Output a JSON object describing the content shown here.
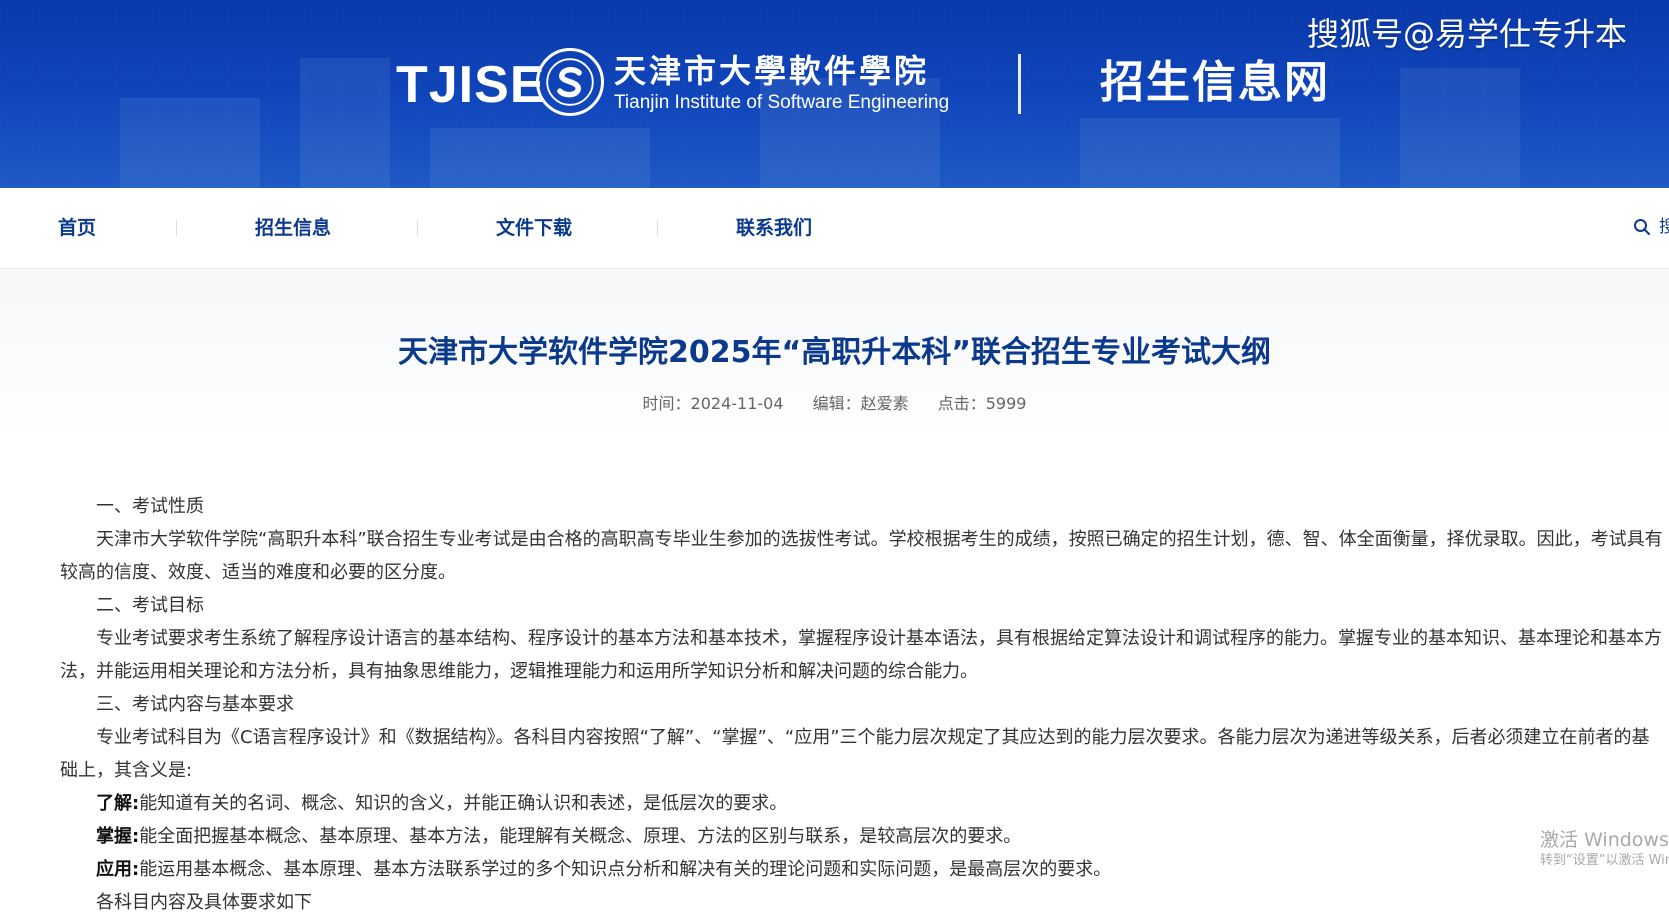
{
  "header": {
    "logo_text": "TJISE",
    "school_name_cn": "天津市大學軟件學院",
    "school_name_en": "Tianjin Institute of Software Engineering",
    "portal_title": "招生信息网",
    "watermark": "搜狐号@易学仕专升本"
  },
  "nav": {
    "items": [
      {
        "label": "首页"
      },
      {
        "label": "招生信息"
      },
      {
        "label": "文件下载"
      },
      {
        "label": "联系我们"
      }
    ],
    "search_label": "搜"
  },
  "article": {
    "title": "天津市大学软件学院2025年“高职升本科”联合招生专业考试大纲",
    "meta": {
      "time": "时间：2024-11-04",
      "editor": "编辑：赵爱素",
      "clicks": "点击：5999"
    },
    "paragraphs": [
      {
        "text": "一、考试性质"
      },
      {
        "text": "天津市大学软件学院“高职升本科”联合招生专业考试是由合格的高职高专毕业生参加的选拔性考试。学校根据考生的成绩，按照已确定的招生计划，德、智、体全面衡量，择优录取。因此，考试具有较高的信度、效度、适当的难度和必要的区分度。"
      },
      {
        "text": "二、考试目标"
      },
      {
        "text": "专业考试要求考生系统了解程序设计语言的基本结构、程序设计的基本方法和基本技术，掌握程序设计基本语法，具有根据给定算法设计和调试程序的能力。掌握专业的基本知识、基本理论和基本方法，并能运用相关理论和方法分析，具有抽象思维能力，逻辑推理能力和运用所学知识分析和解决问题的综合能力。"
      },
      {
        "text": "三、考试内容与基本要求"
      },
      {
        "text": "专业考试科目为《C语言程序设计》和《数据结构》。各科目内容按照“了解”、“掌握”、“应用”三个能力层次规定了其应达到的能力层次要求。各能力层次为递进等级关系，后者必须建立在前者的基础上，其含义是:"
      },
      {
        "bold": "了解:",
        "text": "能知道有关的名词、概念、知识的含义，并能正确认识和表述，是低层次的要求。"
      },
      {
        "bold": "掌握:",
        "text": "能全面把握基本概念、基本原理、基本方法，能理解有关概念、原理、方法的区别与联系，是较高层次的要求。"
      },
      {
        "bold": "应用:",
        "text": "能运用基本概念、基本原理、基本方法联系学过的多个知识点分析和解决有关的理论问题和实际问题，是最高层次的要求。"
      },
      {
        "text": "各科目内容及具体要求如下"
      }
    ]
  },
  "windows_activation": {
    "line1": "激活 Windows",
    "line2": "转到“设置”以激活 Windows。"
  }
}
